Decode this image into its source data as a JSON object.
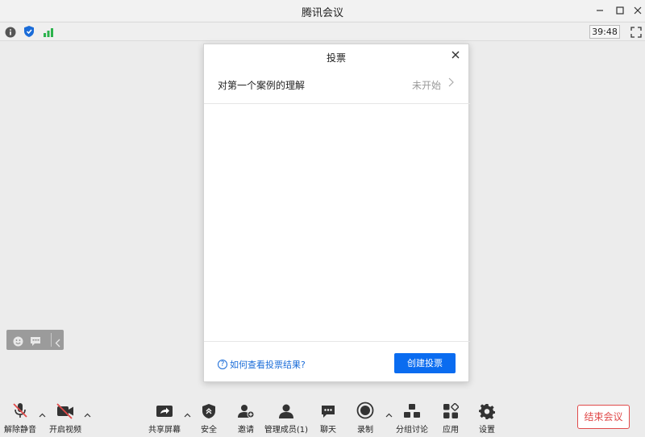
{
  "window": {
    "title": "腾讯会议"
  },
  "infobar": {
    "timer": "39:48"
  },
  "dialog": {
    "title": "投票",
    "poll": {
      "name": "对第一个案例的理解",
      "status": "未开始"
    },
    "help_link": "如何查看投票结果?",
    "create_button": "创建投票"
  },
  "toolbar": {
    "unmute": "解除静音",
    "start_video": "开启视频",
    "share_screen": "共享屏幕",
    "security": "安全",
    "invite": "邀请",
    "members": "管理成员(1)",
    "chat": "聊天",
    "record": "录制",
    "breakout": "分组讨论",
    "apps": "应用",
    "settings": "设置",
    "end_meeting": "结束会议"
  },
  "colors": {
    "accent": "#0a6cf0",
    "danger": "#e04a4a"
  }
}
